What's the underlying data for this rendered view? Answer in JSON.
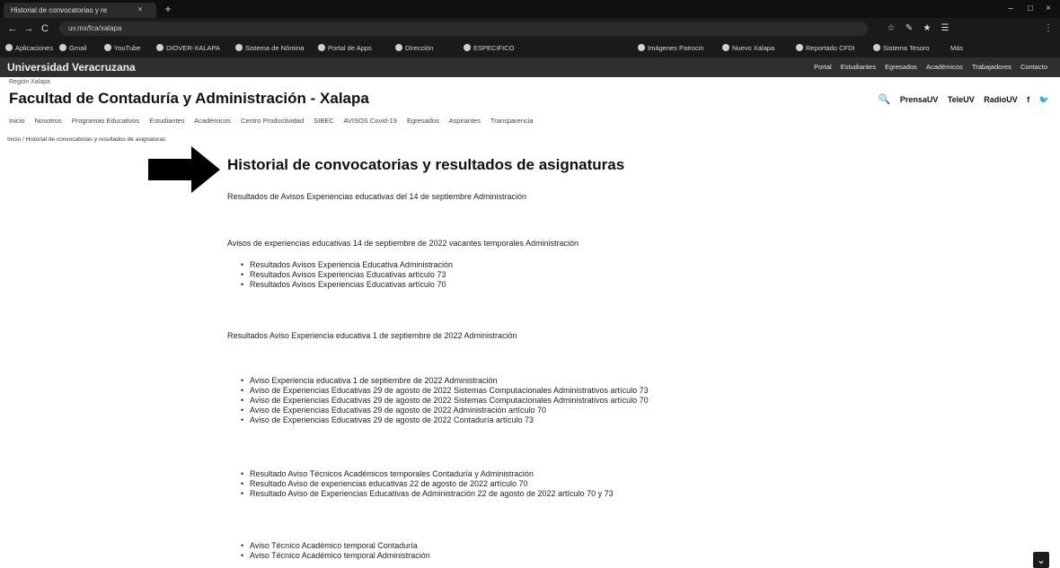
{
  "browser": {
    "tab_title": "Historial de convocatorias y re",
    "tab_close": "×",
    "new_tab": "+",
    "url": "uv.mx/fca/xalapa",
    "nav": {
      "back": "←",
      "forward": "→",
      "reload": "C"
    },
    "window_controls": {
      "minimize": "‒",
      "maximize": "□",
      "close": "×"
    },
    "toolbar_icons": [
      "☆",
      "✎",
      "★",
      "☰",
      "⋮"
    ],
    "bookmarks": [
      "Aplicaciones",
      "Gmail",
      "YouTube",
      "DIOVER-XALAPA",
      "Sistema de Nómina",
      "Portal de Apps",
      "Dirección",
      "ESPECIFICO",
      "Imágenes Patrocin",
      "Nuevo Xalapa",
      "Reportado CFDI",
      "Sistema Tesoro",
      "Más"
    ]
  },
  "site_bar": {
    "brand": "Universidad Veracruzana",
    "links": [
      "Portal",
      "Estudiantes",
      "Egresados",
      "Académicos",
      "Trabajadores",
      "Contacto"
    ]
  },
  "header": {
    "region": "Región Xalapa",
    "title": "Facultad de Contaduría y Administración - Xalapa",
    "social": {
      "search_icon": "🔍",
      "prensa": "PrensaUV",
      "tele": "TeleUV",
      "radio": "RadioUV",
      "facebook": "f",
      "twitter": "🐦"
    }
  },
  "main_nav": [
    "Inicio",
    "Nosotros",
    "Programas Educativos",
    "Estudiantes",
    "Académicos",
    "Centro Productividad",
    "SIBEC",
    "AVISOS Covid-19",
    "Egresados",
    "Aspirantes",
    "Transparencia"
  ],
  "breadcrumb": "Inicio  /  Historial de convocatorias y resultados de asignaturas",
  "page": {
    "title": "Historial de convocatorias y resultados de asignaturas",
    "p1": "Resultados de Avisos Experiencias educativas del 14 de septiembre Administración",
    "p2": "Avisos de experiencias educativas 14 de septiembre de 2022 vacantes temporales Administración",
    "list1": [
      "Resultados Avisos Experiencia Educativa Administración",
      "Resultados Avisos Experiencias Educativas artículo 73",
      "Resultados Avisos Experiencias Educativas artículo 70"
    ],
    "p3": "Resultados Aviso Experiencia educativa 1 de septiembre de 2022 Administración",
    "list2": [
      "Aviso Experiencia educativa 1 de septiembre de 2022 Administración",
      "Aviso de Experiencias Educativas 29 de agosto de 2022 Sistemas Computacionales Administrativos artículo 73",
      "Aviso de Experiencias Educativas 29 de agosto de 2022 Sistemas Computacionales Administrativos artículo 70",
      "Aviso de Experiencias Educativas 29 de agosto de 2022 Administración artículo 70",
      "Aviso de Experiencias Educativas 29 de agosto de 2022 Contaduría artículo 73"
    ],
    "list3": [
      "Resultado Aviso Técnicos Académicos temporales Contaduría y Administración",
      "Resultado Aviso de experiencias educativas 22 de agosto de 2022 artículo 70",
      "Resultado Aviso de Experiencias Educativas de Administración 22 de agosto de 2022 artículo 70 y 73"
    ],
    "list4": [
      "Aviso Técnico Académico temporal Contaduría",
      "Aviso Técnico Académico temporal Administración"
    ]
  },
  "scroll_button": "⌄"
}
